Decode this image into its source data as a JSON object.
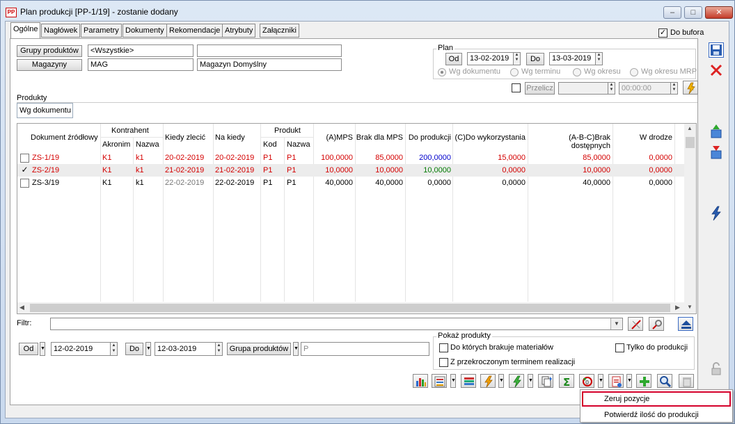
{
  "window": {
    "title": "Plan produkcji [PP-1/19] - zostanie dodany",
    "app_icon": "PP",
    "minimize": "–",
    "maximize": "□",
    "close": "✕"
  },
  "tabs": [
    "Ogólne",
    "Nagłówek",
    "Parametry",
    "Dokumenty",
    "Rekomendacje",
    "Atrybuty",
    "Załączniki"
  ],
  "do_bufora": {
    "label": "Do bufora",
    "mark": "✓"
  },
  "filters": {
    "grupy_label": "Grupy produktów",
    "grupy_value": "<Wszystkie>",
    "grupy_desc": "",
    "magazyny_label": "Magazyny",
    "magazyny_value": "MAG",
    "magazyny_desc": "Magazyn Domyślny"
  },
  "plan": {
    "title": "Plan",
    "od_label": "Od",
    "od_value": "13-02-2019",
    "do_label": "Do",
    "do_value": "13-03-2019",
    "radios": [
      "Wg dokumentu",
      "Wg terminu",
      "Wg okresu",
      "Wg okresu MRP"
    ],
    "przelicz_label": "Przelicz",
    "przelicz_value": "",
    "time_value": "00:00:00"
  },
  "produkty": {
    "title": "Produkty",
    "subtab": "Wg dokumentu"
  },
  "table": {
    "headers": {
      "dokument": "Dokument źródłowy",
      "kontrahent": "Kontrahent",
      "akronim": "Akronim",
      "nazwa": "Nazwa",
      "kiedy_zlecic": "Kiedy zlecić",
      "na_kiedy": "Na kiedy",
      "produkt": "Produkt",
      "kod": "Kod",
      "p_nazwa": "Nazwa",
      "mps": "(A)MPS",
      "brak_mps": "Brak dla MPS",
      "do_produkcji": "Do produkcji",
      "do_wykorzystania": "(C)Do wykorzystania",
      "brak_dostepnych": "(A-B-C)Brak dostępnych",
      "w_drodze": "W drodze"
    },
    "rows": [
      {
        "checked": false,
        "check_mark": "",
        "dokument": "ZS-1/19",
        "akronim": "K1",
        "nazwa": "k1",
        "kiedy_zlecic": "20-02-2019",
        "na_kiedy": "20-02-2019",
        "kod": "P1",
        "p_nazwa": "P1",
        "mps": "100,0000",
        "brak_mps": "85,0000",
        "do_produkcji": "200,0000",
        "do_wykorzystania": "15,0000",
        "brak_dostepnych": "85,0000",
        "w_drodze": "0,0000"
      },
      {
        "checked": true,
        "check_mark": "✓",
        "dokument": "ZS-2/19",
        "akronim": "K1",
        "nazwa": "k1",
        "kiedy_zlecic": "21-02-2019",
        "na_kiedy": "21-02-2019",
        "kod": "P1",
        "p_nazwa": "P1",
        "mps": "10,0000",
        "brak_mps": "10,0000",
        "do_produkcji": "10,0000",
        "do_wykorzystania": "0,0000",
        "brak_dostepnych": "10,0000",
        "w_drodze": "0,0000"
      },
      {
        "checked": false,
        "check_mark": "",
        "dokument": "ZS-3/19",
        "akronim": "K1",
        "nazwa": "k1",
        "kiedy_zlecic": "22-02-2019",
        "na_kiedy": "22-02-2019",
        "kod": "P1",
        "p_nazwa": "P1",
        "mps": "40,0000",
        "brak_mps": "40,0000",
        "do_produkcji": "0,0000",
        "do_wykorzystania": "0,0000",
        "brak_dostepnych": "40,0000",
        "w_drodze": "0,0000"
      }
    ]
  },
  "filtr": {
    "label": "Filtr:",
    "value": ""
  },
  "bottom": {
    "od_label": "Od",
    "od_value": "12-02-2019",
    "do_label": "Do",
    "do_value": "12-03-2019",
    "grupa_label": "Grupa produktów",
    "grupa_value": "P"
  },
  "pokaz": {
    "title": "Pokaż produkty",
    "opt1": "Do których brakuje materiałów",
    "opt2": "Z przekroczonym terminem realizacji",
    "opt3": "Tylko do produkcji"
  },
  "context_menu": {
    "item1": "Zeruj pozycje",
    "item2": "Potwierdź ilość do produkcji"
  },
  "colors": {
    "red": "#d40000",
    "blue": "#0000cc",
    "green": "#007a00",
    "menu_highlight": "#d4002a"
  }
}
